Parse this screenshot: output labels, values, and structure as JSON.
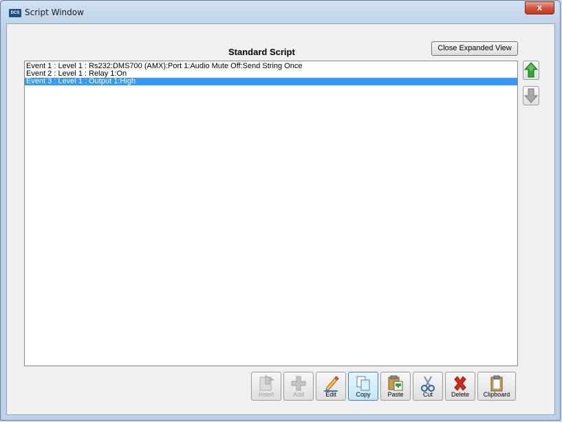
{
  "window": {
    "title": "Script Window",
    "app_icon_text": "DCS",
    "close_glyph": "x"
  },
  "panel": {
    "heading": "Standard Script",
    "expand_button_label": "Close Expanded View"
  },
  "events": [
    {
      "text": "Event 1 : Level 1 : Rs232:DMS700 (AMX):Port 1:Audio Mute Off:Send String Once",
      "selected": false
    },
    {
      "text": "Event 2 : Level 1 : Relay 1:On",
      "selected": false
    },
    {
      "text": "Event 3 : Level 1 : Output 1:High",
      "selected": true
    }
  ],
  "move_buttons": {
    "up_icon": "green-up-arrow-icon",
    "down_icon": "gray-down-arrow-icon"
  },
  "toolbar": {
    "insert_label": "Insert",
    "add_label": "Add",
    "edit_label": "Edit",
    "copy_label": "Copy",
    "paste_label": "Paste",
    "cut_label": "Cut",
    "delete_label": "Delete",
    "clipboard_label": "Clipboard"
  },
  "colors": {
    "selection": "#3399ff",
    "up_arrow": "#2fa62f",
    "delete_x": "#d42a1a"
  }
}
